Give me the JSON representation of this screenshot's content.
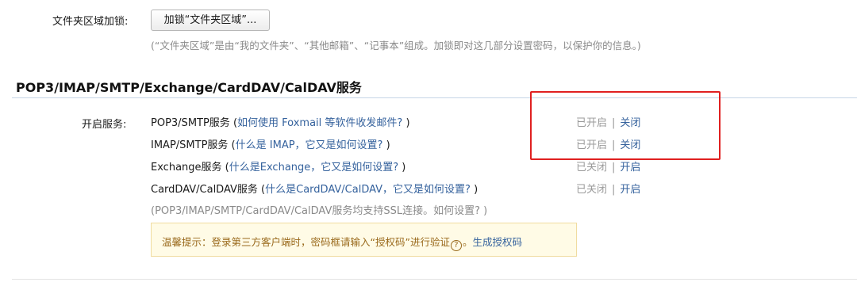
{
  "folder_lock": {
    "label": "文件夹区域加锁:",
    "button_label": "加锁“文件夹区域”...",
    "note": "(“文件夹区域”是由“我的文件夹”、“其他邮箱”、“记事本”组成。加锁即对这几部分设置密码，以保护你的信息。)"
  },
  "section": {
    "title": "POP3/IMAP/SMTP/Exchange/CardDAV/CalDAV服务",
    "services_label": "开启服务:"
  },
  "services": [
    {
      "name": "POP3/SMTP服务",
      "open_paren": " (",
      "help": "如何使用 Foxmail 等软件收发邮件?",
      "close_paren": " )",
      "state": "已开启",
      "separator": "|",
      "action": "关闭"
    },
    {
      "name": "IMAP/SMTP服务",
      "open_paren": " (",
      "help": "什么是 IMAP，它又是如何设置?",
      "close_paren": " )",
      "state": "已开启",
      "separator": "|",
      "action": "关闭"
    },
    {
      "name": "Exchange服务",
      "open_paren": " (",
      "help": "什么是Exchange，它又是如何设置?",
      "close_paren": " )",
      "state": "已关闭",
      "separator": "|",
      "action": "开启"
    },
    {
      "name": "CardDAV/CalDAV服务",
      "open_paren": " (",
      "help": "什么是CardDAV/CalDAV，它又是如何设置?",
      "close_paren": " )",
      "state": "已关闭",
      "separator": "|",
      "action": "开启"
    }
  ],
  "ssl_note": {
    "text": "(POP3/IMAP/SMTP/CardDAV/CalDAV服务均支持SSL连接。",
    "link": "如何设置?",
    "close": " )"
  },
  "tip": {
    "text": "温馨提示：登录第三方客户端时，密码框请输入“授权码”进行验证",
    "icon_glyph": "?",
    "separator": "。",
    "link": "生成授权码"
  },
  "colors": {
    "link": "#35629d",
    "muted": "#9a9a9a",
    "highlight_border": "#e02020",
    "tip_background": "#fffbe6"
  }
}
